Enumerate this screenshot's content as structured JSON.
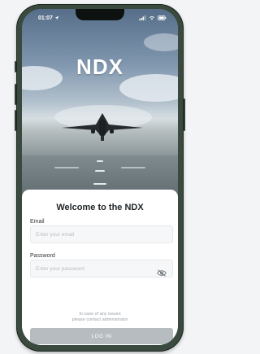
{
  "status_bar": {
    "time": "01:07",
    "location_icon": "location-arrow-icon",
    "signal_icon": "cellular-signal-icon",
    "wifi_icon": "wifi-icon",
    "battery_icon": "battery-icon"
  },
  "brand": {
    "logo_text": "NDX"
  },
  "login": {
    "title": "Welcome to the NDX",
    "email_label": "Email",
    "email_placeholder": "Enter your email",
    "email_value": "",
    "password_label": "Password",
    "password_placeholder": "Enter your password",
    "password_value": "",
    "password_toggle_icon": "eye-slash-icon",
    "help_line1": "In case of any issues",
    "help_line2": "please contact administrator",
    "submit_label": "LOG IN"
  },
  "colors": {
    "login_button_disabled": "#b7bcc0",
    "input_background": "#f6f7f8",
    "phone_frame": "#3a4a3f"
  }
}
